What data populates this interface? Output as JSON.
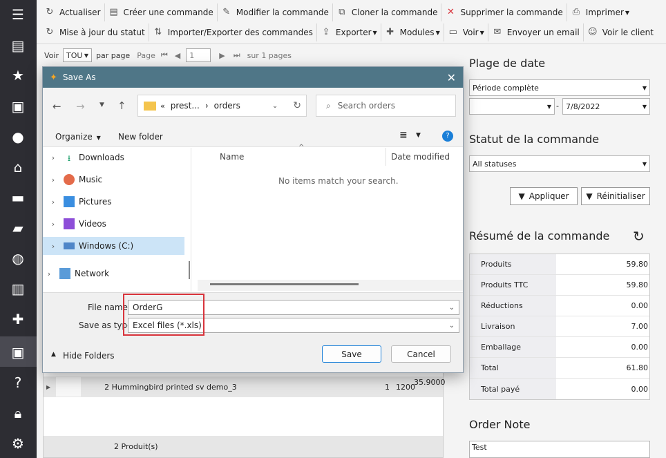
{
  "toolbar": {
    "row1": [
      {
        "label": "Actualiser",
        "icon": "refresh-icon"
      },
      {
        "label": "Créer une commande",
        "icon": "new-order-icon"
      },
      {
        "label": "Modifier la commande",
        "icon": "pencil-icon"
      },
      {
        "label": "Cloner la commande",
        "icon": "clone-icon"
      },
      {
        "label": "Supprimer la commande",
        "icon": "delete-icon"
      },
      {
        "label": "Imprimer",
        "icon": "printer-icon"
      }
    ],
    "row2": [
      {
        "label": "Mise à jour du statut",
        "icon": "refresh-icon"
      },
      {
        "label": "Importer/Exporter des commandes",
        "icon": "import-export-icon"
      },
      {
        "label": "Exporter",
        "icon": "upload-icon"
      },
      {
        "label": "Modules",
        "icon": "puzzle-icon"
      },
      {
        "label": "Voir",
        "icon": "view-icon"
      },
      {
        "label": "Envoyer un email",
        "icon": "mail-icon"
      },
      {
        "label": "Voir le client",
        "icon": "user-view-icon"
      }
    ]
  },
  "pager": {
    "voir": "Voir",
    "per_page_value": "TOU",
    "par_page": "par page",
    "page_label": "Page",
    "page_value": "1",
    "total": "sur 1 pages"
  },
  "grid": {
    "row_label": "2 Hummingbird printed sv demo_3",
    "row_qty": "1",
    "row_ref": "1200",
    "row_price": "35.9000",
    "footer": "2 Produit(s)"
  },
  "right_panel": {
    "date_heading": "Plage de date",
    "date_range": "Période complète",
    "date_from": "",
    "date_sep": "-",
    "date_to": "7/8/2022",
    "status_heading": "Statut de la commande",
    "status_value": "All statuses",
    "apply": "Appliquer",
    "reset": "Réinitialiser",
    "summary_heading": "Résumé de la commande",
    "summary": [
      {
        "label": "Produits",
        "value": "59.80"
      },
      {
        "label": "Produits TTC",
        "value": "59.80"
      },
      {
        "label": "Réductions",
        "value": "0.00"
      },
      {
        "label": "Livraison",
        "value": "7.00"
      },
      {
        "label": "Emballage",
        "value": "0.00"
      },
      {
        "label": "Total",
        "value": "61.80"
      },
      {
        "label": "Total payé",
        "value": "0.00"
      }
    ],
    "note_heading": "Order Note",
    "note_value": "Test"
  },
  "dialog": {
    "title": "Save As",
    "breadcrumb": [
      "«",
      "prest...",
      "›",
      "orders"
    ],
    "search_placeholder": "Search orders",
    "organize": "Organize",
    "new_folder": "New folder",
    "tree": [
      {
        "label": "Downloads",
        "icon": "download-icon"
      },
      {
        "label": "Music",
        "icon": "music-icon"
      },
      {
        "label": "Pictures",
        "icon": "pictures-icon"
      },
      {
        "label": "Videos",
        "icon": "videos-icon"
      },
      {
        "label": "Windows (C:)",
        "icon": "drive-icon"
      },
      {
        "label": "Network",
        "icon": "network-icon"
      }
    ],
    "col_name": "Name",
    "col_date": "Date modified",
    "empty_message": "No items match your search.",
    "file_name_label": "File name",
    "file_name_value": "OrderG",
    "save_type_label": "Save as type",
    "save_type_value": "Excel files (*.xls)",
    "hide_folders": "Hide Folders",
    "save": "Save",
    "cancel": "Cancel"
  },
  "colors": {
    "sidebar": "#2d2d33",
    "dialog_title": "#4f7687",
    "highlight": "#d8333b",
    "selected": "#cce4f7"
  }
}
